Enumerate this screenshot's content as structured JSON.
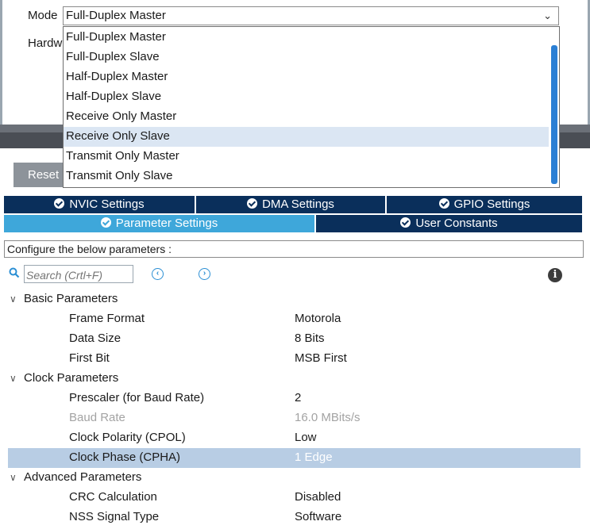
{
  "mode": {
    "label": "Mode",
    "selected": "Full-Duplex Master",
    "hardware_label": "Hardw"
  },
  "dropdown": {
    "options": [
      "Full-Duplex Master",
      "Full-Duplex Slave",
      "Half-Duplex Master",
      "Half-Duplex Slave",
      "Receive Only Master",
      "Receive Only Slave",
      "Transmit Only Master",
      "Transmit Only Slave"
    ],
    "highlighted": "Receive Only Slave"
  },
  "reset_button": {
    "label": "Reset"
  },
  "tabs": {
    "row1": [
      "NVIC Settings",
      "DMA Settings",
      "GPIO Settings"
    ],
    "row2": [
      "Parameter Settings",
      "User Constants"
    ],
    "active": "Parameter Settings"
  },
  "configure_text": "Configure the below parameters :",
  "search": {
    "placeholder": "Search (Crtl+F)"
  },
  "groups": [
    {
      "name": "Basic Parameters",
      "params": [
        {
          "name": "Frame Format",
          "value": "Motorola"
        },
        {
          "name": "Data Size",
          "value": "8 Bits"
        },
        {
          "name": "First Bit",
          "value": "MSB First"
        }
      ]
    },
    {
      "name": "Clock Parameters",
      "params": [
        {
          "name": "Prescaler (for Baud Rate)",
          "value": "2"
        },
        {
          "name": "Baud Rate",
          "value": "16.0 MBits/s",
          "disabled": true
        },
        {
          "name": "Clock Polarity (CPOL)",
          "value": "Low"
        },
        {
          "name": "Clock Phase (CPHA)",
          "value": "1 Edge",
          "selected": true
        }
      ]
    },
    {
      "name": "Advanced Parameters",
      "params": [
        {
          "name": "CRC Calculation",
          "value": "Disabled"
        },
        {
          "name": "NSS Signal Type",
          "value": "Software"
        }
      ]
    }
  ],
  "colors": {
    "tab_dark": "#0a2f5b",
    "tab_active": "#3ea7da",
    "selection": "#b8cde4",
    "accent_blue": "#2b7fd4"
  }
}
